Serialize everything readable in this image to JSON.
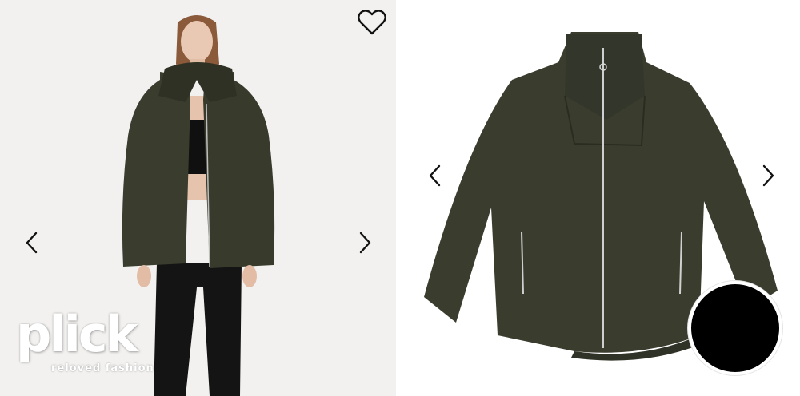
{
  "brand": {
    "name": "plick",
    "tagline": "reloved fashion"
  },
  "gallery": {
    "left_image": "model-wearing-olive-fleece-jacket",
    "right_image": "olive-fleece-jacket-product-shot",
    "product_color": "#3a3d2e",
    "swatch_color": "#000000"
  },
  "icons": {
    "favorite": "heart-outline-icon",
    "prev": "chevron-left-icon",
    "next": "chevron-right-icon"
  }
}
